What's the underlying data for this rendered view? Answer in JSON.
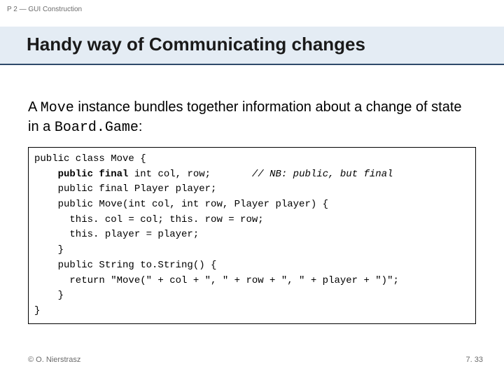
{
  "breadcrumb": "P 2 — GUI Construction",
  "title": "Handy way of Communicating changes",
  "body": {
    "prefix": "A ",
    "code1": "Move",
    "mid": " instance bundles together information about a change of state in a ",
    "code2": "Board.Game",
    "suffix": ":"
  },
  "code": {
    "l1": "public class Move {",
    "l2a": "    ",
    "l2b": "public final",
    "l2c": " int col, row;       ",
    "l2d": "// NB: public, but final",
    "l3": "    public final Player player;",
    "l4": "    public Move(int col, int row, Player player) {",
    "l5": "      this. col = col; this. row = row;",
    "l6": "      this. player = player;",
    "l7": "    }",
    "l8": "    public String to.String() {",
    "l9": "      return \"Move(\" + col + \", \" + row + \", \" + player + \")\";",
    "l10": "    }",
    "l11": "}"
  },
  "footer": {
    "left": "© O. Nierstrasz",
    "right": "7. 33"
  }
}
